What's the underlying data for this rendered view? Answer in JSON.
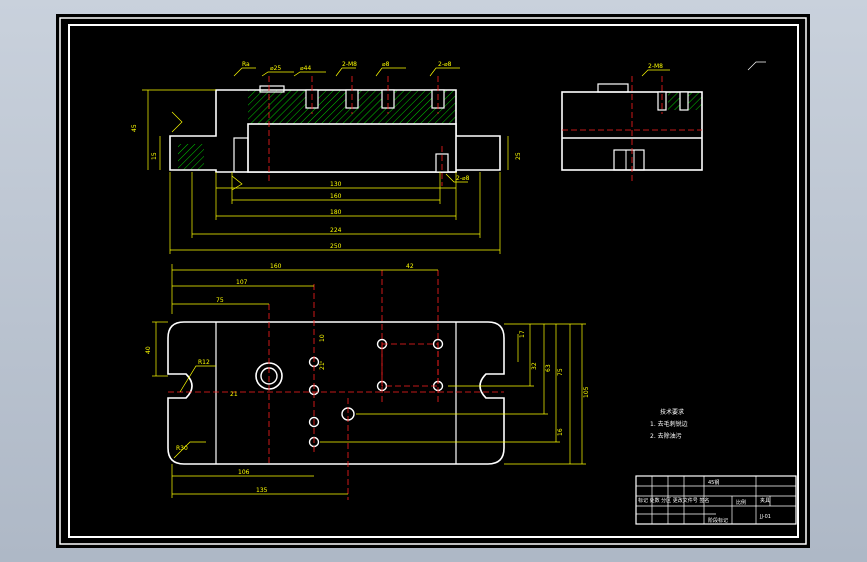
{
  "drawing": {
    "colors": {
      "outline": "#ffffff",
      "dimension": "#ffff00",
      "hatch": "#00cc00",
      "centerline": "#ff2020",
      "background": "#000000",
      "viewport": "#b7c0cc"
    },
    "front_view": {
      "top_callouts": [
        "⌀25",
        "⌀44",
        "2-M8",
        "⌀8",
        "2-⌀8",
        "2-⌀8"
      ],
      "left_dims": [
        "45",
        "15"
      ],
      "right_dim": "25",
      "bottom_dims": [
        "130",
        "160",
        "180",
        "224",
        "250"
      ],
      "small_right_callout": "2-⌀8"
    },
    "side_view": {
      "top_callout": "2-M8"
    },
    "plan_view": {
      "top_dims": [
        "160",
        "42",
        "107",
        "75"
      ],
      "left_dim": "40",
      "hole_dims": [
        "10",
        "21",
        "21"
      ],
      "radius_labels": [
        "R12",
        "R30"
      ],
      "right_dims": [
        "17",
        "32",
        "63",
        "75",
        "105",
        "16"
      ],
      "bottom_dims": [
        "106",
        "135"
      ]
    },
    "tech_notes": {
      "title": "技术要求",
      "lines": [
        "1. 去毛刺锐边",
        "2. 去除油污"
      ]
    },
    "title_block": {
      "part_name": "夹具",
      "material": "45钢",
      "row_labels": [
        "标记 处数 分区 更改文件号 签名"
      ],
      "drawing_no": "JJ-01",
      "scale_labels": [
        "阶段标记",
        "重量",
        "比例"
      ]
    },
    "roughness_note": "Ra"
  }
}
